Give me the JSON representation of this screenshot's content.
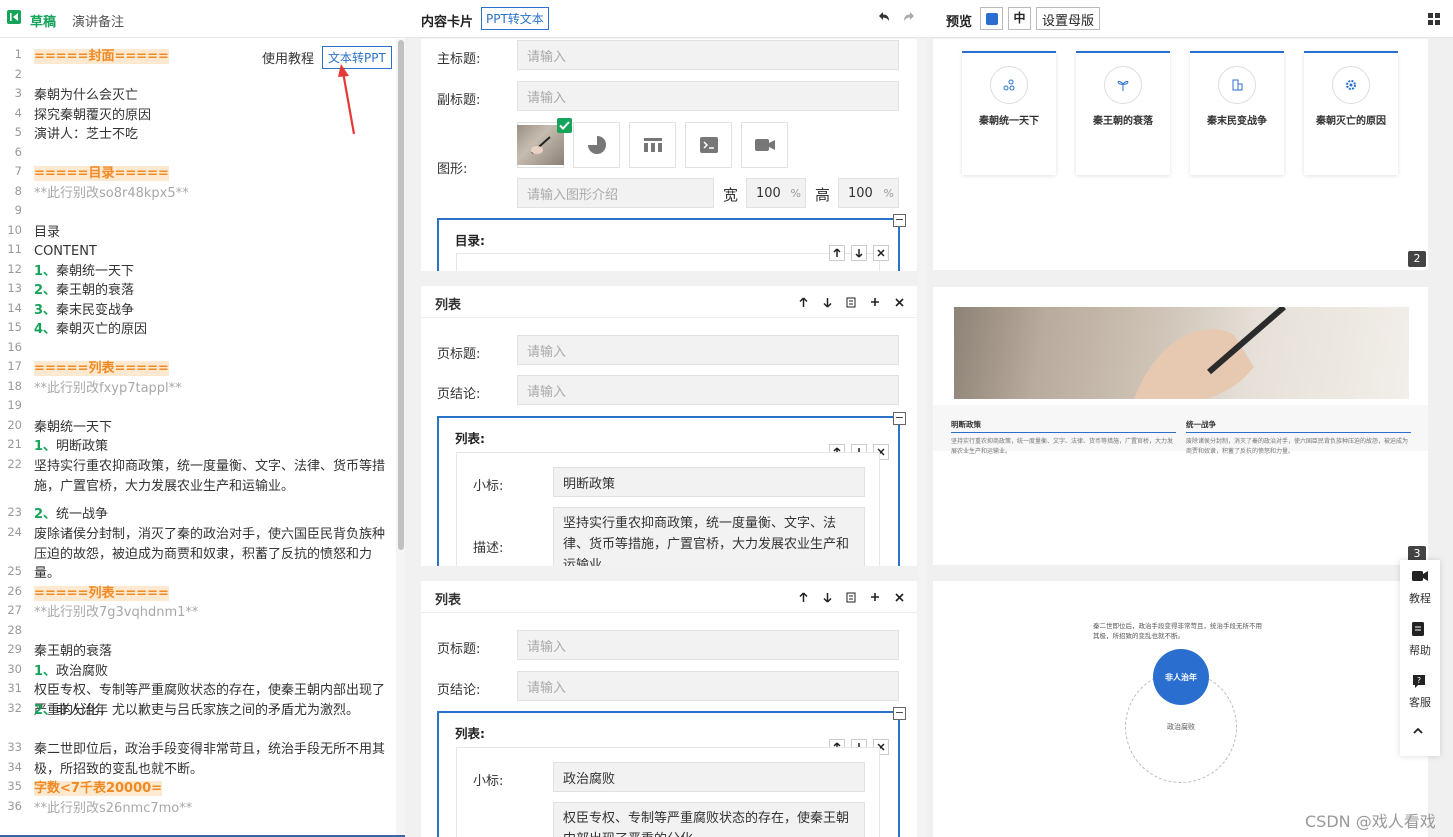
{
  "left": {
    "tabs": [
      "草稿",
      "演讲备注"
    ],
    "help_link": "使用教程",
    "convert_button": "文本转PPT",
    "lines": [
      {
        "n": "1",
        "parts": [
          {
            "t": "=====封面=====",
            "c": "sec"
          }
        ]
      },
      {
        "n": "2",
        "parts": []
      },
      {
        "n": "3",
        "parts": [
          {
            "t": "秦朝为什么会灭亡",
            "c": ""
          }
        ]
      },
      {
        "n": "4",
        "parts": [
          {
            "t": "探究秦朝覆灭的原因",
            "c": ""
          }
        ]
      },
      {
        "n": "5",
        "parts": [
          {
            "t": "演讲人：芝士不吃",
            "c": ""
          }
        ]
      },
      {
        "n": "6",
        "parts": []
      },
      {
        "n": "7",
        "parts": [
          {
            "t": "=====目录=====",
            "c": "sec"
          }
        ]
      },
      {
        "n": "8",
        "parts": [
          {
            "t": "**此行别改so8r48kpx5**",
            "c": "cmt"
          }
        ]
      },
      {
        "n": "9",
        "parts": []
      },
      {
        "n": "10",
        "parts": [
          {
            "t": "目录",
            "c": ""
          }
        ]
      },
      {
        "n": "11",
        "parts": [
          {
            "t": "CONTENT",
            "c": ""
          }
        ]
      },
      {
        "n": "12",
        "parts": [
          {
            "t": "1、",
            "c": "num"
          },
          {
            "t": "秦朝统一天下",
            "c": ""
          }
        ]
      },
      {
        "n": "13",
        "parts": [
          {
            "t": "2、",
            "c": "num"
          },
          {
            "t": "秦王朝的衰落",
            "c": ""
          }
        ]
      },
      {
        "n": "14",
        "parts": [
          {
            "t": "3、",
            "c": "num"
          },
          {
            "t": "秦末民变战争",
            "c": ""
          }
        ]
      },
      {
        "n": "15",
        "parts": [
          {
            "t": "4、",
            "c": "num"
          },
          {
            "t": "秦朝灭亡的原因",
            "c": ""
          }
        ]
      },
      {
        "n": "16",
        "parts": []
      },
      {
        "n": "17",
        "parts": [
          {
            "t": "=====列表=====",
            "c": "sec"
          }
        ]
      },
      {
        "n": "18",
        "parts": [
          {
            "t": "**此行别改fxyp7tappl**",
            "c": "cmt"
          }
        ]
      },
      {
        "n": "19",
        "parts": []
      },
      {
        "n": "20",
        "parts": [
          {
            "t": "秦朝统一天下",
            "c": ""
          }
        ]
      },
      {
        "n": "21",
        "parts": [
          {
            "t": "1、",
            "c": "num"
          },
          {
            "t": "明断政策",
            "c": ""
          }
        ]
      },
      {
        "n": "22",
        "parts": [
          {
            "t": "坚持实行重农抑商政策，统一度量衡、文字、法律、货币等措施，广置官桥，大力发展农业生产和运输业。",
            "c": ""
          }
        ]
      },
      {
        "n": "23",
        "parts": [
          {
            "t": "2、",
            "c": "num"
          },
          {
            "t": "统一战争",
            "c": ""
          }
        ]
      },
      {
        "n": "24",
        "parts": [
          {
            "t": "废除诸侯分封制，消灭了秦的政治对手，使六国臣民背负族种压迫的故怨，被迫成为商贾和奴隶，积蓄了反抗的愤怒和力量。",
            "c": ""
          }
        ]
      },
      {
        "n": "25",
        "parts": []
      },
      {
        "n": "26",
        "parts": [
          {
            "t": "=====列表=====",
            "c": "sec"
          }
        ]
      },
      {
        "n": "27",
        "parts": [
          {
            "t": "**此行别改7g3vqhdnm1**",
            "c": "cmt"
          }
        ]
      },
      {
        "n": "28",
        "parts": []
      },
      {
        "n": "29",
        "parts": [
          {
            "t": "秦王朝的衰落",
            "c": ""
          }
        ]
      },
      {
        "n": "30",
        "parts": [
          {
            "t": "1、",
            "c": "num"
          },
          {
            "t": "政治腐败",
            "c": ""
          }
        ]
      },
      {
        "n": "31",
        "parts": [
          {
            "t": "权臣专权、专制等严重腐败状态的存在，使秦王朝内部出现了严重的分化，尤以歉吏与吕氏家族之间的矛盾尤为激烈。",
            "c": ""
          }
        ]
      },
      {
        "n": "32",
        "parts": [
          {
            "t": "2、",
            "c": "num"
          },
          {
            "t": "非人治年",
            "c": ""
          }
        ]
      },
      {
        "n": "33",
        "parts": [
          {
            "t": "秦二世即位后，政治手段变得非常苛且，统治手段无所不用其极，所招致的变乱也就不断。",
            "c": ""
          }
        ]
      },
      {
        "n": "34",
        "parts": []
      },
      {
        "n": "35",
        "parts": [
          {
            "t": "字数<7千表20000=",
            "c": "sec"
          }
        ]
      },
      {
        "n": "36",
        "parts": [
          {
            "t": "**此行别改s26nmc7mo**",
            "c": "cmt"
          }
        ]
      }
    ]
  },
  "middle": {
    "title": "内容卡片",
    "ppt_to_text_button": "PPT转文本",
    "cover_card": {
      "main_title_label": "主标题:",
      "main_title_placeholder": "请输入",
      "subtitle_label": "副标题:",
      "subtitle_placeholder": "请输入",
      "graphic_label": "图形:",
      "graphic_intro_placeholder": "请输入图形介绍",
      "width_label": "宽",
      "width_value": "100",
      "height_label": "高",
      "height_value": "100",
      "percent": "%",
      "toc_label": "目录:"
    },
    "list_card_1": {
      "title": "列表",
      "page_title_label": "页标题:",
      "page_title_placeholder": "请输入",
      "conclusion_label": "页结论:",
      "conclusion_placeholder": "请输入",
      "list_label": "列表:",
      "small_title_label": "小标:",
      "small_title_value": "明断政策",
      "desc_label": "描述:",
      "desc_value": "坚持实行重农抑商政策，统一度量衡、文字、法律、货币等措施，广置官桥，大力发展农业生产和运输业。"
    },
    "list_card_2": {
      "title": "列表",
      "page_title_label": "页标题:",
      "page_title_placeholder": "请输入",
      "conclusion_label": "页结论:",
      "conclusion_placeholder": "请输入",
      "list_label": "列表:",
      "small_title_label": "小标:",
      "small_title_value": "政治腐败",
      "desc_value": "权臣专权、专制等严重腐败状态的存在，使秦王朝内部出现了严重的分化"
    }
  },
  "right": {
    "title": "预览",
    "size_button": "中",
    "master_button": "设置母版",
    "slide2": {
      "items": [
        "秦朝统一天下",
        "秦王朝的衰落",
        "秦末民变战争",
        "秦朝灭亡的原因"
      ],
      "page": "2"
    },
    "slide3": {
      "col1_title": "明断政策",
      "col1_text": "坚持实行重农抑商政策，统一度量衡、文字、法律、货币等措施，广置官桥，大力发展农业生产和运输业。",
      "col2_title": "统一战争",
      "col2_text": "废除诸侯分封制，消灭了秦的政治对手，使六国臣民背负族种压迫的故怨，被迫成为商贾和奴隶，积蓄了反抗的愤怒和力量。",
      "page": "3"
    },
    "slide4": {
      "text": "秦二世即位后，政治手段变得非常苛且，统治手段无所不用其极，所招致的变乱也就不断。",
      "circle_label": "非人治年",
      "dashed_label": "政治腐败"
    }
  },
  "dock": {
    "tutorial": "教程",
    "help": "帮助",
    "service": "客服"
  },
  "watermark": "CSDN @戏人看戏",
  "colors": {
    "accent_blue": "#2a73c9",
    "accent_green": "#16a35a",
    "section_orange": "#f08a24"
  }
}
